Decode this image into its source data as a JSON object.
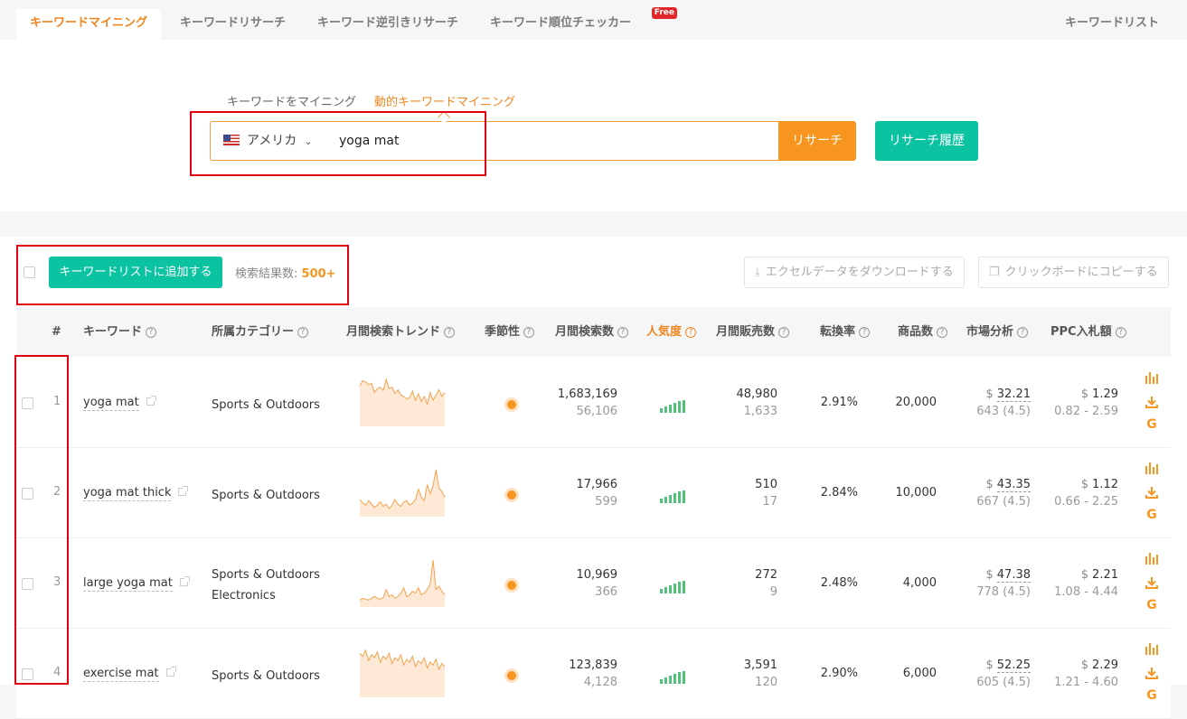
{
  "tabs": [
    {
      "label": "キーワードマイニング",
      "active": true
    },
    {
      "label": "キーワードリサーチ"
    },
    {
      "label": "キーワード逆引きリサーチ"
    },
    {
      "label": "キーワード順位チェッカー",
      "badge": "Free"
    }
  ],
  "tabs_right": "キーワードリスト",
  "search": {
    "modes": [
      "キーワードをマイニング",
      "動的キーワードマイニング"
    ],
    "active_mode": "動的キーワードマイニング",
    "country": "アメリカ",
    "query": "yoga mat",
    "research_button": "リサーチ",
    "history_button": "リサーチ履歴"
  },
  "toolbar": {
    "add_button": "キーワードリストに追加する",
    "result_label": "検索結果数:",
    "result_count": "500+",
    "excel_button": "エクセルデータをダウンロードする",
    "copy_button": "クリックボードにコピーする"
  },
  "colors": {
    "accent_orange": "#f7951e",
    "accent_teal": "#0cc3a1",
    "highlight_red": "#e0000f",
    "bar_green": "#52c17a"
  },
  "columns": [
    "#",
    "キーワード",
    "所属カテゴリー",
    "月間検索トレンド",
    "季節性",
    "月間検索数",
    "人気度",
    "月間販売数",
    "転換率",
    "商品数",
    "市場分析",
    "PPC入札額"
  ],
  "rows": [
    {
      "num": "1",
      "keyword": "yoga mat",
      "categories": [
        "Sports & Outdoors"
      ],
      "searches": "1,683,169",
      "searches_sub": "56,106",
      "sales": "48,980",
      "sales_sub": "1,633",
      "conversion": "2.91%",
      "products": "20,000",
      "market": "32.21",
      "market_sub": "643 (4.5)",
      "ppc": "1.29",
      "ppc_range": "0.82 - 2.59",
      "trend": [
        62,
        70,
        68,
        64,
        66,
        52,
        58,
        60,
        55,
        72,
        58,
        60,
        50,
        56,
        48,
        46,
        42,
        44,
        54,
        40,
        50,
        38,
        46,
        34,
        52,
        40,
        48,
        56,
        46,
        52
      ]
    },
    {
      "num": "2",
      "keyword": "yoga mat thick",
      "categories": [
        "Sports & Outdoors"
      ],
      "searches": "17,966",
      "searches_sub": "599",
      "sales": "510",
      "sales_sub": "17",
      "conversion": "2.84%",
      "products": "10,000",
      "market": "43.35",
      "market_sub": "667 (4.5)",
      "ppc": "1.12",
      "ppc_range": "0.66 - 2.25",
      "trend": [
        30,
        24,
        20,
        28,
        22,
        16,
        20,
        26,
        18,
        22,
        14,
        20,
        30,
        22,
        18,
        26,
        28,
        20,
        24,
        30,
        48,
        34,
        28,
        56,
        40,
        54,
        82,
        50,
        44,
        34
      ]
    },
    {
      "num": "3",
      "keyword": "large yoga mat",
      "categories": [
        "Sports & Outdoors",
        "Electronics"
      ],
      "searches": "10,969",
      "searches_sub": "366",
      "sales": "272",
      "sales_sub": "9",
      "conversion": "2.48%",
      "products": "4,000",
      "market": "47.38",
      "market_sub": "778 (4.5)",
      "ppc": "2.21",
      "ppc_range": "1.08 - 4.44",
      "trend": [
        8,
        10,
        9,
        8,
        10,
        12,
        10,
        9,
        11,
        20,
        12,
        14,
        10,
        12,
        16,
        22,
        12,
        14,
        18,
        16,
        22,
        14,
        16,
        20,
        26,
        54,
        20,
        24,
        18,
        14
      ]
    },
    {
      "num": "4",
      "keyword": "exercise mat",
      "categories": [
        "Sports & Outdoors"
      ],
      "searches": "123,839",
      "searches_sub": "4,128",
      "sales": "3,591",
      "sales_sub": "120",
      "conversion": "2.90%",
      "products": "6,000",
      "market": "52.25",
      "market_sub": "605 (4.5)",
      "ppc": "2.29",
      "ppc_range": "1.21 - 4.60",
      "trend": [
        60,
        56,
        64,
        50,
        58,
        54,
        62,
        48,
        56,
        52,
        60,
        46,
        54,
        50,
        58,
        44,
        52,
        48,
        56,
        42,
        50,
        46,
        54,
        40,
        48,
        44,
        52,
        38,
        46,
        42
      ]
    }
  ]
}
